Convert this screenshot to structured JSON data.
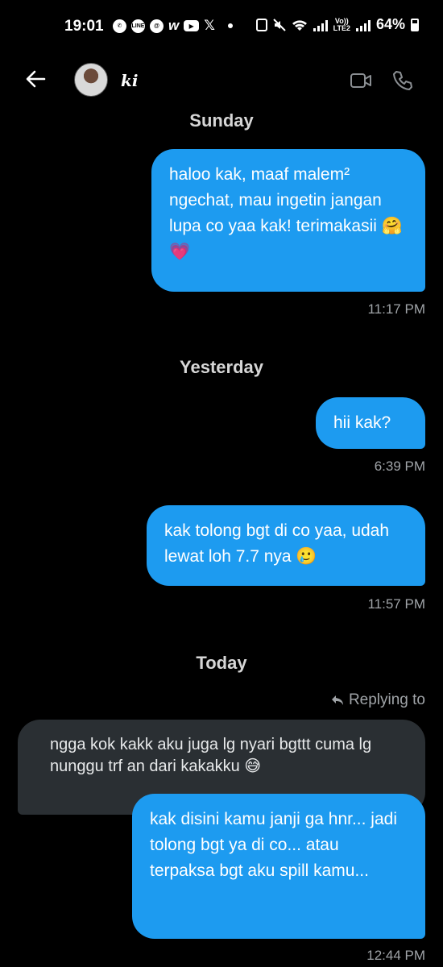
{
  "status": {
    "time": "19:01",
    "apps": [
      "whatsapp",
      "line",
      "threads",
      "webtoon",
      "youtube",
      "x"
    ],
    "line_label": "LINE",
    "x_label": "𝕏",
    "w_label": "w",
    "lte_label": "Vo))\nLTE2",
    "battery": "64%"
  },
  "header": {
    "contact_name": "ki"
  },
  "messages": {
    "day1": "Sunday",
    "m1_text": "haloo kak, maaf malem² ngechat, mau ingetin jangan lupa co yaa kak! terimakasii 🤗💗",
    "m1_time": "11:17 PM",
    "day2": "Yesterday",
    "m2_text": "hii kak?",
    "m2_time": "6:39 PM",
    "m3_text": "kak tolong bgt di co yaa, udah lewat loh 7.7 nya 🥲",
    "m3_time": "11:57 PM",
    "day3": "Today",
    "reply_label": "Replying to",
    "m4_text": "ngga kok kakk aku juga lg nyari bgttt cuma lg nunggu trf an dari kakakku 😅",
    "m5_text": "kak disini kamu janji ga hnr... jadi tolong bgt ya di co... atau terpaksa bgt aku spill kamu...",
    "m5_time": "12:44 PM"
  },
  "colors": {
    "background": "#000000",
    "outgoing_bubble": "#1d9bf0",
    "incoming_bubble": "#2a2f33",
    "muted_text": "#a0a4a8"
  }
}
